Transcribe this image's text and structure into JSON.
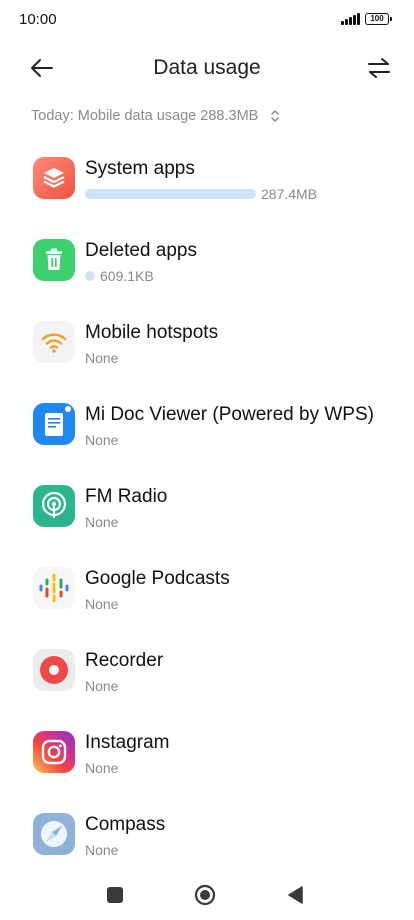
{
  "status": {
    "time": "10:00",
    "battery": "100"
  },
  "header": {
    "title": "Data usage",
    "back_icon": "arrow-left-icon",
    "action_icon": "swap-arrows-icon"
  },
  "summary": {
    "text": "Today: Mobile data usage 288.3MB"
  },
  "apps": [
    {
      "name": "System apps",
      "sub": "287.4MB",
      "usage_fraction": 0.997,
      "icon": "system-apps-icon"
    },
    {
      "name": "Deleted apps",
      "sub": "609.1KB",
      "usage_fraction": 0.002,
      "icon": "trash-icon"
    },
    {
      "name": "Mobile hotspots",
      "sub": "None",
      "icon": "wifi-hotspot-icon"
    },
    {
      "name": "Mi Doc Viewer (Powered by WPS)",
      "sub": "None",
      "icon": "document-icon"
    },
    {
      "name": "FM Radio",
      "sub": "None",
      "icon": "radio-icon"
    },
    {
      "name": "Google Podcasts",
      "sub": "None",
      "icon": "podcasts-icon"
    },
    {
      "name": "Recorder",
      "sub": "None",
      "icon": "recorder-icon"
    },
    {
      "name": "Instagram",
      "sub": "None",
      "icon": "instagram-icon"
    },
    {
      "name": "Compass",
      "sub": "None",
      "icon": "compass-icon"
    }
  ],
  "colors": {
    "usage_bar": "#cfe3f8",
    "secondary_text": "#8a8a8a"
  },
  "nav": {
    "recents_icon": "square-icon",
    "home_icon": "circle-icon",
    "back_icon": "triangle-back-icon"
  }
}
